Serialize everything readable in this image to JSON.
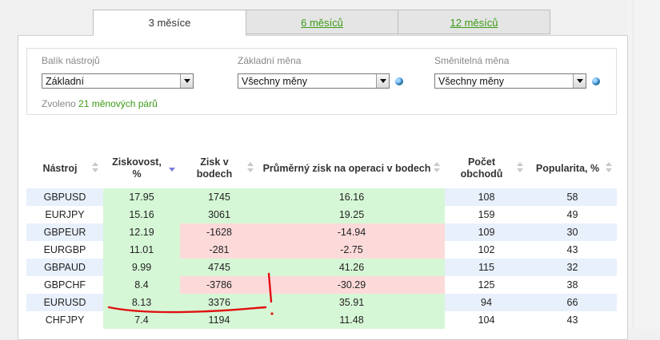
{
  "tabs": [
    {
      "label": "3 měsíce",
      "active": true
    },
    {
      "label": "6 měsíců",
      "active": false
    },
    {
      "label": "12 měsíců",
      "active": false
    }
  ],
  "filters": {
    "toolset": {
      "label": "Balík nástrojů",
      "value": "Základní"
    },
    "base_currency": {
      "label": "Základní měna",
      "value": "Všechny měny"
    },
    "counter_currency": {
      "label": "Směnitelná měna",
      "value": "Všechny měny"
    },
    "selected_prefix": "Zvoleno",
    "selected_link": "21 měnových párů"
  },
  "table": {
    "headers": [
      {
        "label": "Nástroj"
      },
      {
        "label": "Ziskovost, %",
        "sorted": "desc"
      },
      {
        "label": "Zisk v bodech"
      },
      {
        "label": "Průměrný zisk na operaci v bodech"
      },
      {
        "label": "Počet obchodů"
      },
      {
        "label": "Popularita, %"
      }
    ],
    "rows": [
      {
        "instrument": "GBPUSD",
        "profitability": "17.95",
        "points": "1745",
        "avg": "16.16",
        "trades": "108",
        "popularity": "58"
      },
      {
        "instrument": "EURJPY",
        "profitability": "15.16",
        "points": "3061",
        "avg": "19.25",
        "trades": "159",
        "popularity": "49"
      },
      {
        "instrument": "GBPEUR",
        "profitability": "12.19",
        "points": "-1628",
        "avg": "-14.94",
        "trades": "109",
        "popularity": "30"
      },
      {
        "instrument": "EURGBP",
        "profitability": "11.01",
        "points": "-281",
        "avg": "-2.75",
        "trades": "102",
        "popularity": "43"
      },
      {
        "instrument": "GBPAUD",
        "profitability": "9.99",
        "points": "4745",
        "avg": "41.26",
        "trades": "115",
        "popularity": "32"
      },
      {
        "instrument": "GBPCHF",
        "profitability": "8.4",
        "points": "-3786",
        "avg": "-30.29",
        "trades": "125",
        "popularity": "38"
      },
      {
        "instrument": "EURUSD",
        "profitability": "8.13",
        "points": "3376",
        "avg": "35.91",
        "trades": "94",
        "popularity": "66"
      },
      {
        "instrument": "CHFJPY",
        "profitability": "7.4",
        "points": "1194",
        "avg": "11.48",
        "trades": "104",
        "popularity": "43"
      }
    ]
  },
  "colors": {
    "accent_link": "#3a9a14",
    "positive_cell": "#d6f7d6",
    "negative_cell": "#fddada",
    "alt_row": "#e8f0fc",
    "annotation": "#e01010"
  }
}
